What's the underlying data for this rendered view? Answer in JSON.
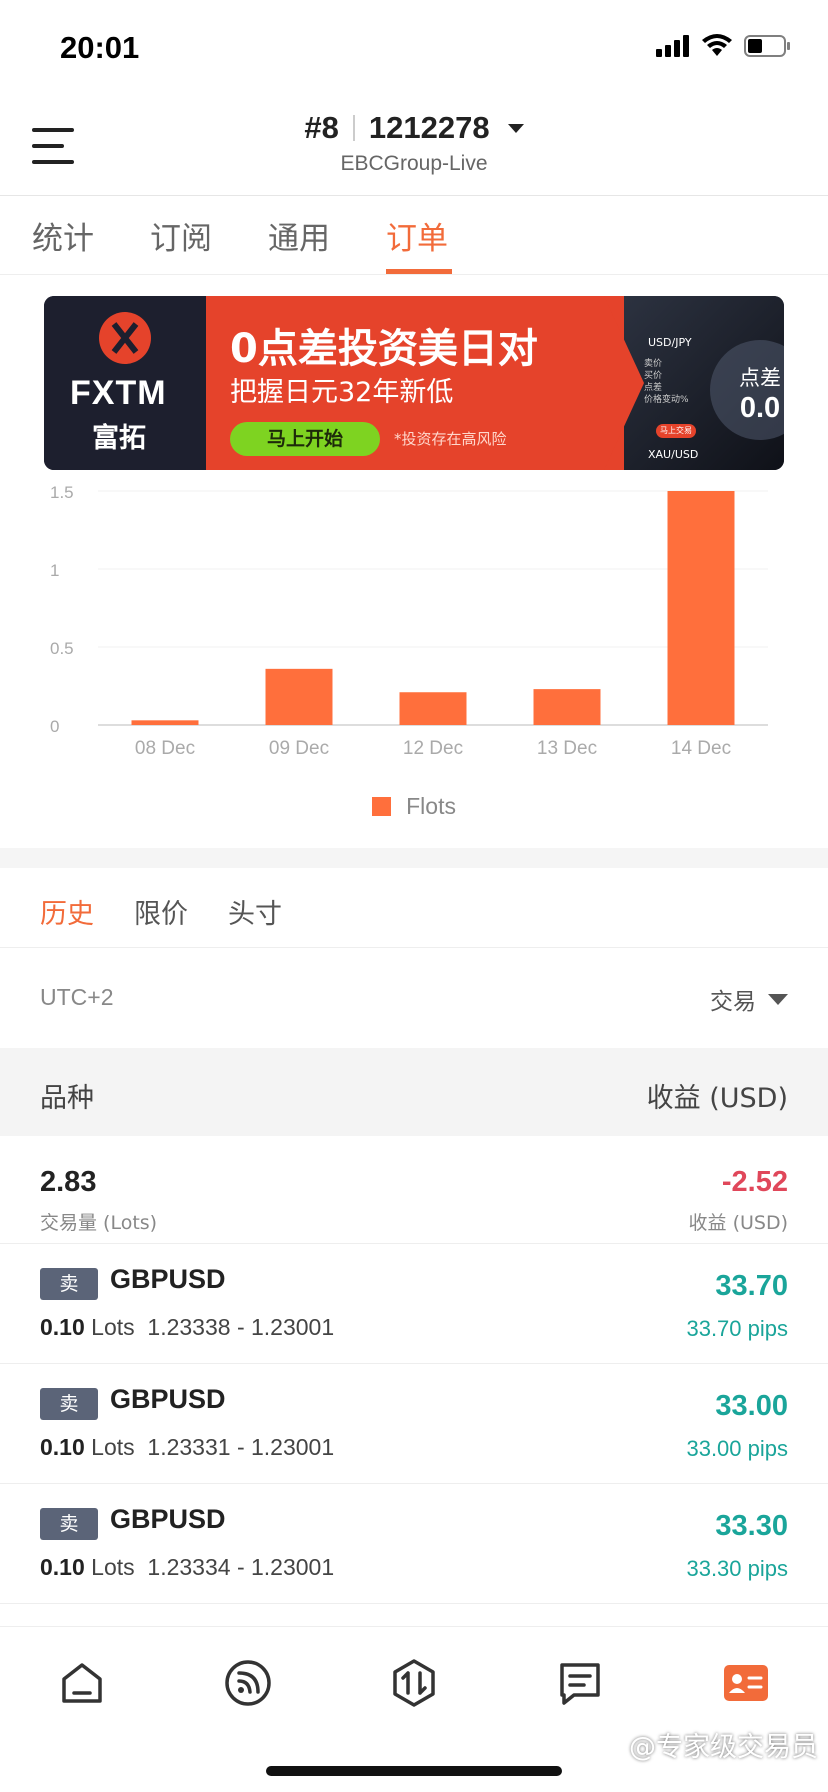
{
  "status_bar": {
    "time": "20:01"
  },
  "header": {
    "account_index": "#8",
    "account_number": "1212278",
    "server": "EBCGroup-Live"
  },
  "top_tabs": [
    "统计",
    "订阅",
    "通用",
    "订单"
  ],
  "top_tabs_active": "订单",
  "banner": {
    "brand_en": "FXTM",
    "brand_cn": "富拓",
    "headline": "0点差投资美日对",
    "sub": "把握日元32年新低",
    "cta": "马上开始",
    "risk": "*投资存在高风险",
    "phone_pair1": "USD/JPY",
    "phone_rows": [
      "卖价",
      "买价",
      "点差",
      "价格变动%"
    ],
    "phone_btn": "马上交易",
    "phone_pair2": "XAU/USD",
    "spread_label": "点差",
    "spread_value": "0.0"
  },
  "chart_data": {
    "type": "bar",
    "categories": [
      "08 Dec",
      "09 Dec",
      "12 Dec",
      "13 Dec",
      "14 Dec"
    ],
    "series": [
      {
        "name": "Flots",
        "values": [
          0.03,
          0.36,
          0.21,
          0.23,
          1.5
        ]
      }
    ],
    "ytick_labels": [
      "0",
      "0.5",
      "1",
      "1.5"
    ],
    "ylim": [
      0,
      1.5
    ],
    "legend": "bottom-center",
    "bar_color": "#ff6f3c"
  },
  "sub_tabs": [
    "历史",
    "限价",
    "头寸"
  ],
  "sub_tabs_active": "历史",
  "filter": {
    "timezone": "UTC+2",
    "trade_filter": "交易"
  },
  "table_header": {
    "symbol": "品种",
    "profit": "收益 (USD)"
  },
  "summary": {
    "volume": "2.83",
    "volume_label": "交易量 (Lots)",
    "profit": "-2.52",
    "profit_label": "收益 (USD)"
  },
  "orders": [
    {
      "side": "卖",
      "symbol": "GBPUSD",
      "lots": "0.10",
      "lots_unit": "Lots",
      "prices": "1.23338 - 1.23001",
      "profit": "33.70",
      "pips": "33.70 pips"
    },
    {
      "side": "卖",
      "symbol": "GBPUSD",
      "lots": "0.10",
      "lots_unit": "Lots",
      "prices": "1.23331 - 1.23001",
      "profit": "33.00",
      "pips": "33.00 pips"
    },
    {
      "side": "卖",
      "symbol": "GBPUSD",
      "lots": "0.10",
      "lots_unit": "Lots",
      "prices": "1.23334 - 1.23001",
      "profit": "33.30",
      "pips": "33.30 pips"
    }
  ],
  "bottom_nav": [
    {
      "icon": "home-icon"
    },
    {
      "icon": "feed-icon"
    },
    {
      "icon": "trade-icon"
    },
    {
      "icon": "message-icon"
    },
    {
      "icon": "profile-card-icon",
      "active": true
    }
  ],
  "watermark": "@专家级交易员",
  "colors": {
    "accent": "#f26b3a",
    "positive": "#1aa59a",
    "negative": "#e0475a",
    "bar": "#ff6f3c"
  }
}
